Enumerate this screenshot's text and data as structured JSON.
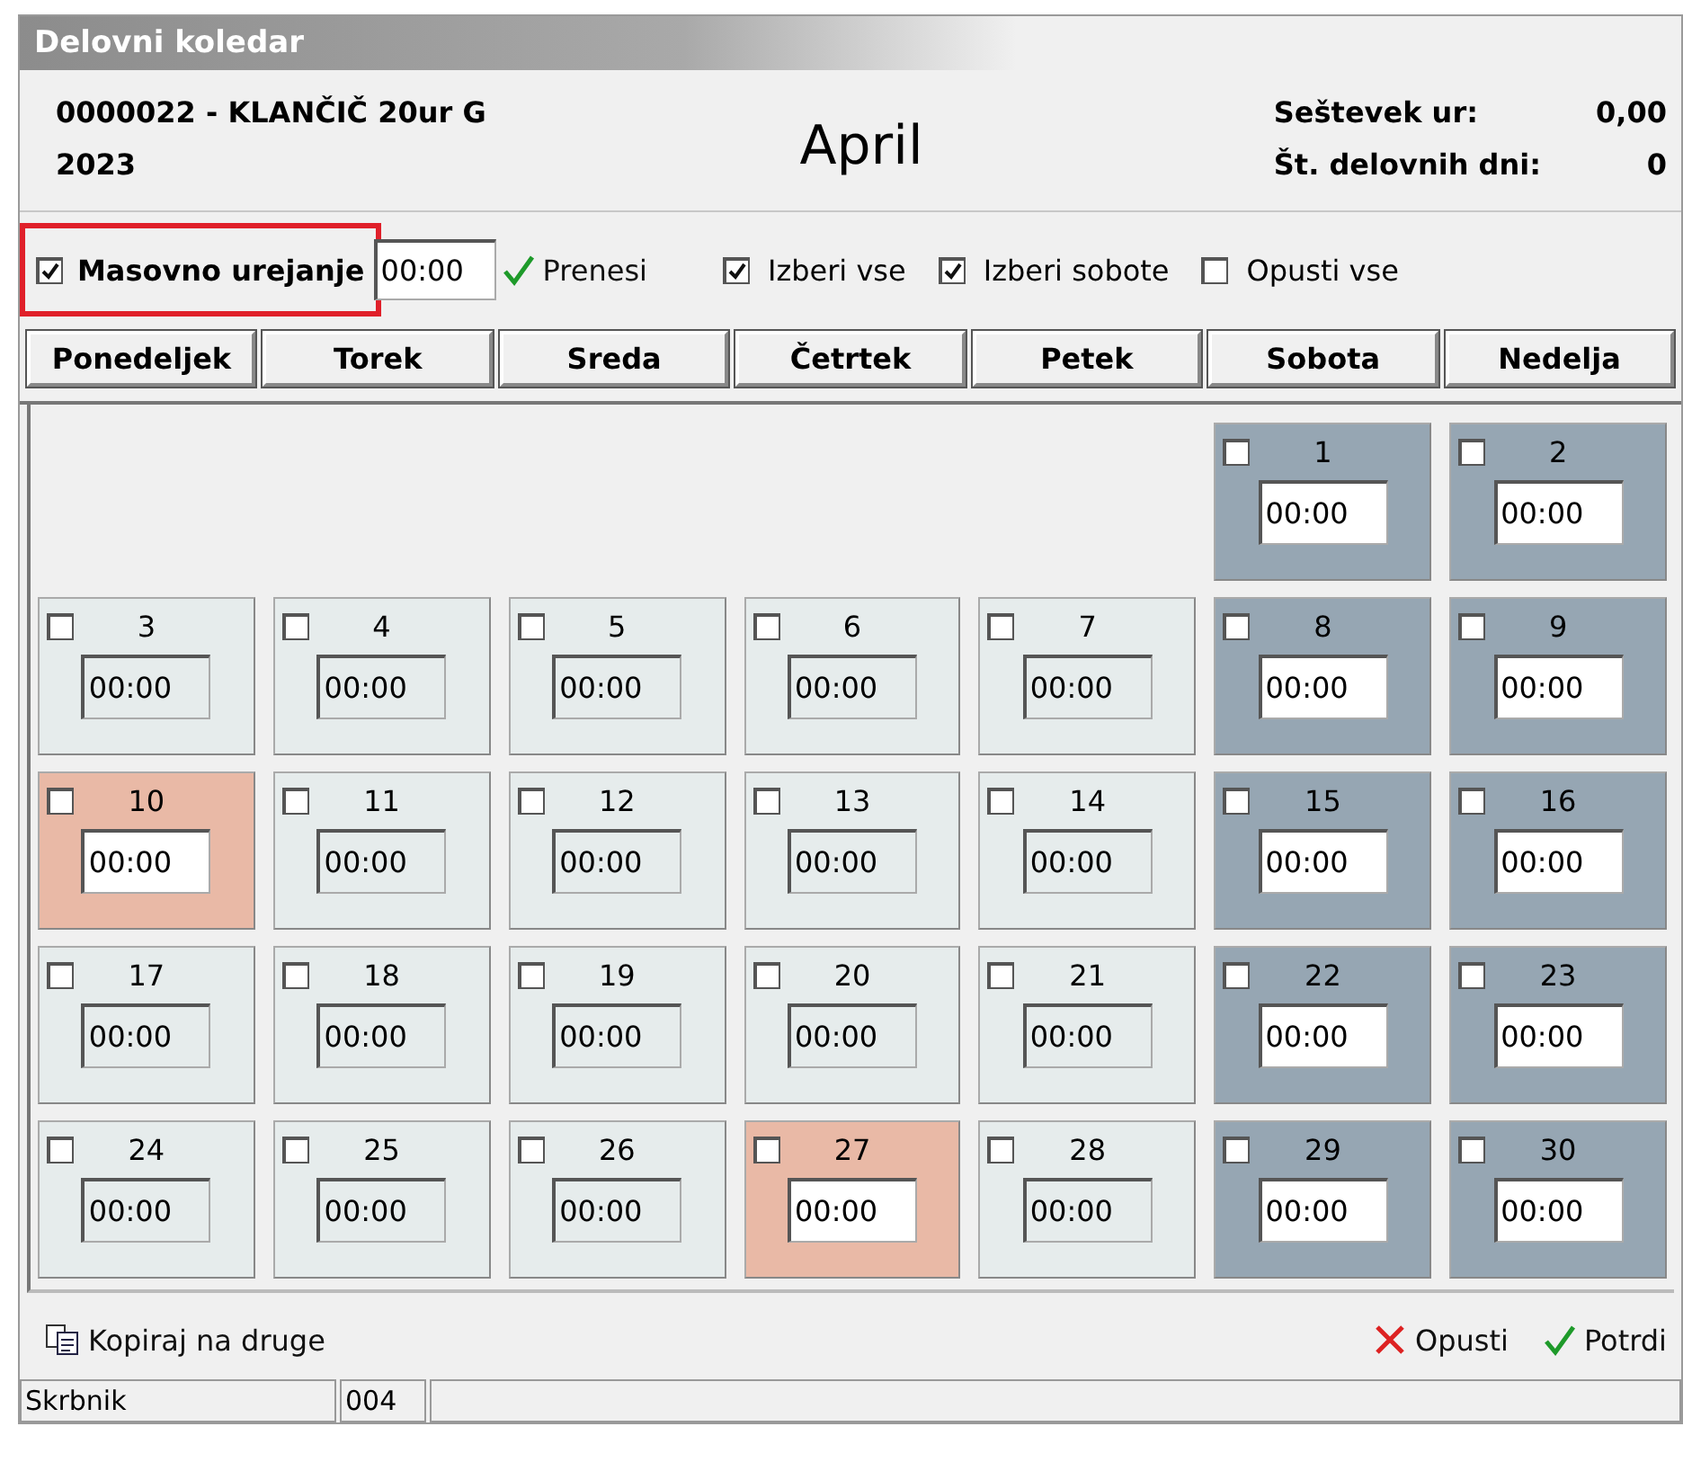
{
  "window": {
    "title": "Delovni koledar"
  },
  "header": {
    "employee": "0000022 - KLANČIČ 20ur G",
    "year": "2023",
    "month": "April",
    "summary": [
      {
        "label": "Seštevek ur:",
        "value": "0,00"
      },
      {
        "label": "Št. delovnih dni:",
        "value": "0"
      }
    ]
  },
  "toolbar": {
    "mass_edit": {
      "label": "Masovno urejanje",
      "checked": true,
      "highlighted": true
    },
    "time_field": {
      "value": "00:00"
    },
    "apply": {
      "label": "Prenesi"
    },
    "toggles": [
      {
        "label": "Izberi vse",
        "checked": true
      },
      {
        "label": "Izberi sobote",
        "checked": true
      },
      {
        "label": "Opusti vse",
        "checked": false
      }
    ]
  },
  "weekdays": [
    "Ponedeljek",
    "Torek",
    "Sreda",
    "Četrtek",
    "Petek",
    "Sobota",
    "Nedelja"
  ],
  "days": [
    {
      "kind": "blank"
    },
    {
      "kind": "blank"
    },
    {
      "kind": "blank"
    },
    {
      "kind": "blank"
    },
    {
      "kind": "blank"
    },
    {
      "kind": "weekend",
      "day": "1",
      "hours": "00:00",
      "checked": false
    },
    {
      "kind": "weekend",
      "day": "2",
      "hours": "00:00",
      "checked": false
    },
    {
      "kind": "workday",
      "day": "3",
      "hours": "00:00",
      "checked": false
    },
    {
      "kind": "workday",
      "day": "4",
      "hours": "00:00",
      "checked": false
    },
    {
      "kind": "workday",
      "day": "5",
      "hours": "00:00",
      "checked": false
    },
    {
      "kind": "workday",
      "day": "6",
      "hours": "00:00",
      "checked": false
    },
    {
      "kind": "workday",
      "day": "7",
      "hours": "00:00",
      "checked": false
    },
    {
      "kind": "weekend",
      "day": "8",
      "hours": "00:00",
      "checked": false
    },
    {
      "kind": "weekend",
      "day": "9",
      "hours": "00:00",
      "checked": false
    },
    {
      "kind": "holiday",
      "day": "10",
      "hours": "00:00",
      "checked": false
    },
    {
      "kind": "workday",
      "day": "11",
      "hours": "00:00",
      "checked": false
    },
    {
      "kind": "workday",
      "day": "12",
      "hours": "00:00",
      "checked": false
    },
    {
      "kind": "workday",
      "day": "13",
      "hours": "00:00",
      "checked": false
    },
    {
      "kind": "workday",
      "day": "14",
      "hours": "00:00",
      "checked": false
    },
    {
      "kind": "weekend",
      "day": "15",
      "hours": "00:00",
      "checked": false
    },
    {
      "kind": "weekend",
      "day": "16",
      "hours": "00:00",
      "checked": false
    },
    {
      "kind": "workday",
      "day": "17",
      "hours": "00:00",
      "checked": false
    },
    {
      "kind": "workday",
      "day": "18",
      "hours": "00:00",
      "checked": false
    },
    {
      "kind": "workday",
      "day": "19",
      "hours": "00:00",
      "checked": false
    },
    {
      "kind": "workday",
      "day": "20",
      "hours": "00:00",
      "checked": false
    },
    {
      "kind": "workday",
      "day": "21",
      "hours": "00:00",
      "checked": false
    },
    {
      "kind": "weekend",
      "day": "22",
      "hours": "00:00",
      "checked": false
    },
    {
      "kind": "weekend",
      "day": "23",
      "hours": "00:00",
      "checked": false
    },
    {
      "kind": "workday",
      "day": "24",
      "hours": "00:00",
      "checked": false
    },
    {
      "kind": "workday",
      "day": "25",
      "hours": "00:00",
      "checked": false
    },
    {
      "kind": "workday",
      "day": "26",
      "hours": "00:00",
      "checked": false
    },
    {
      "kind": "holiday",
      "day": "27",
      "hours": "00:00",
      "checked": false
    },
    {
      "kind": "workday",
      "day": "28",
      "hours": "00:00",
      "checked": false
    },
    {
      "kind": "weekend",
      "day": "29",
      "hours": "00:00",
      "checked": false
    },
    {
      "kind": "weekend",
      "day": "30",
      "hours": "00:00",
      "checked": false
    }
  ],
  "footer": {
    "copy": {
      "label": "Kopiraj na druge"
    },
    "cancel": {
      "label": "Opusti"
    },
    "confirm": {
      "label": "Potrdi"
    }
  },
  "status_bar": [
    "Skrbnik",
    "004"
  ]
}
